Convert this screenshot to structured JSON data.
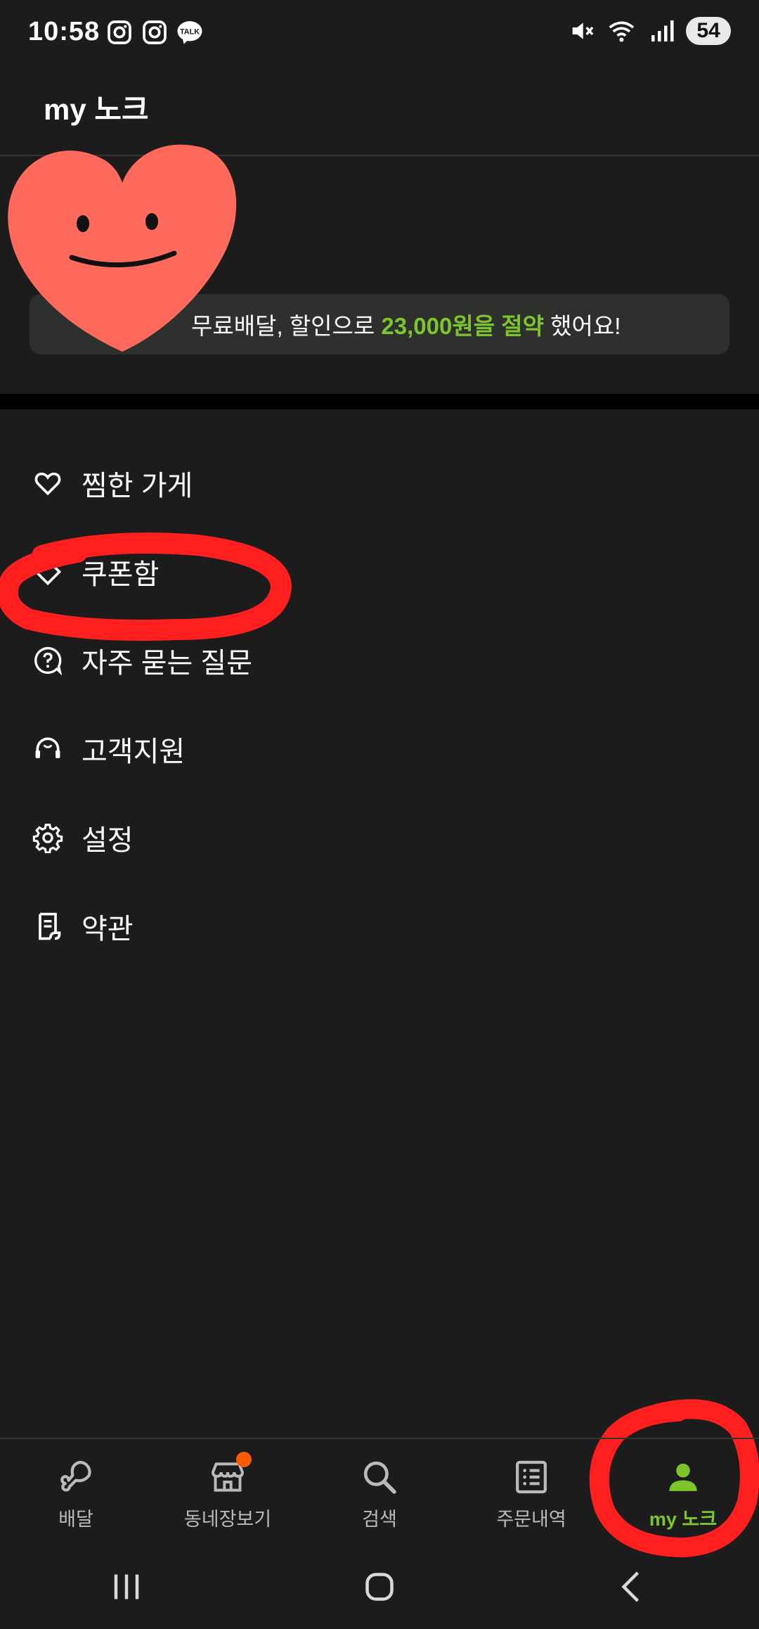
{
  "status_bar": {
    "time": "10:58",
    "left_icons": [
      "instagram-icon",
      "instagram-icon",
      "kakaotalk-icon"
    ],
    "kakao_label": "TALK",
    "right_icons": [
      "mute-icon",
      "wifi-icon",
      "signal-icon"
    ],
    "battery": "54"
  },
  "header": {
    "title": "my 노크"
  },
  "profile": {
    "savings_pre": "무료배달, 할인으로",
    "savings_amount": "23,000원을 절약",
    "savings_post": "했어요!"
  },
  "menu": {
    "items": [
      {
        "label": "찜한 가게",
        "icon": "heart-icon"
      },
      {
        "label": "쿠폰함",
        "icon": "coupon-icon"
      },
      {
        "label": "자주 묻는 질문",
        "icon": "faq-icon"
      },
      {
        "label": "고객지원",
        "icon": "headset-icon"
      },
      {
        "label": "설정",
        "icon": "gear-icon"
      },
      {
        "label": "약관",
        "icon": "document-icon"
      }
    ]
  },
  "bottom_nav": {
    "items": [
      {
        "label": "배달",
        "icon": "chicken-leg-icon"
      },
      {
        "label": "동네장보기",
        "icon": "store-icon"
      },
      {
        "label": "검색",
        "icon": "search-icon"
      },
      {
        "label": "주문내역",
        "icon": "order-list-icon"
      },
      {
        "label": "my 노크",
        "icon": "user-icon"
      }
    ],
    "active_index": 4
  },
  "colors": {
    "background": "#1b1c1b",
    "accent": "#7dc52b",
    "banner": "#2e302e",
    "badge": "#ff5a00",
    "annotation": "#ff1f1f",
    "sticker": "#ff6a5c"
  }
}
